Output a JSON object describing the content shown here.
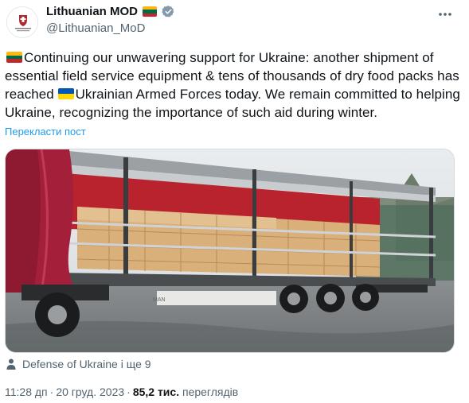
{
  "tweet": {
    "author": {
      "display_name": "Lithuanian MOD",
      "handle": "@Lithuanian_MoD",
      "flag_icon": "lithuania-flag-icon",
      "verified_icon": "verified-badge-icon",
      "avatar_icon": "ministry-emblem-icon"
    },
    "more_icon": "more-options-icon",
    "text_parts": {
      "part1": "Continuing our unwavering support for Ukraine: another shipment of essential field service equipment & tens of thousands of dry food packs has reached ",
      "part2": "Ukrainian Armed Forces today. We remain committed to helping Ukraine, recognizing the importance of such aid during winter."
    },
    "translate_label": "Перекласти пост",
    "media": {
      "icon": "truck-photo-icon",
      "photo_text": "MAN"
    },
    "tagged": {
      "icon": "person-icon",
      "label": "Defense of Ukraine і ще 9"
    },
    "meta": {
      "time": "11:28 дп",
      "separator": "·",
      "date": "20 груд. 2023",
      "views_count": "85,2 тис.",
      "views_label": "переглядів"
    }
  },
  "colors": {
    "text": "#0f1419",
    "secondary": "#536471",
    "accent": "#1d9bf0",
    "lithuania_flag": [
      "#FDB913",
      "#006A44",
      "#C1272D"
    ],
    "ukraine_flag": [
      "#0057B7",
      "#FFD700"
    ]
  }
}
